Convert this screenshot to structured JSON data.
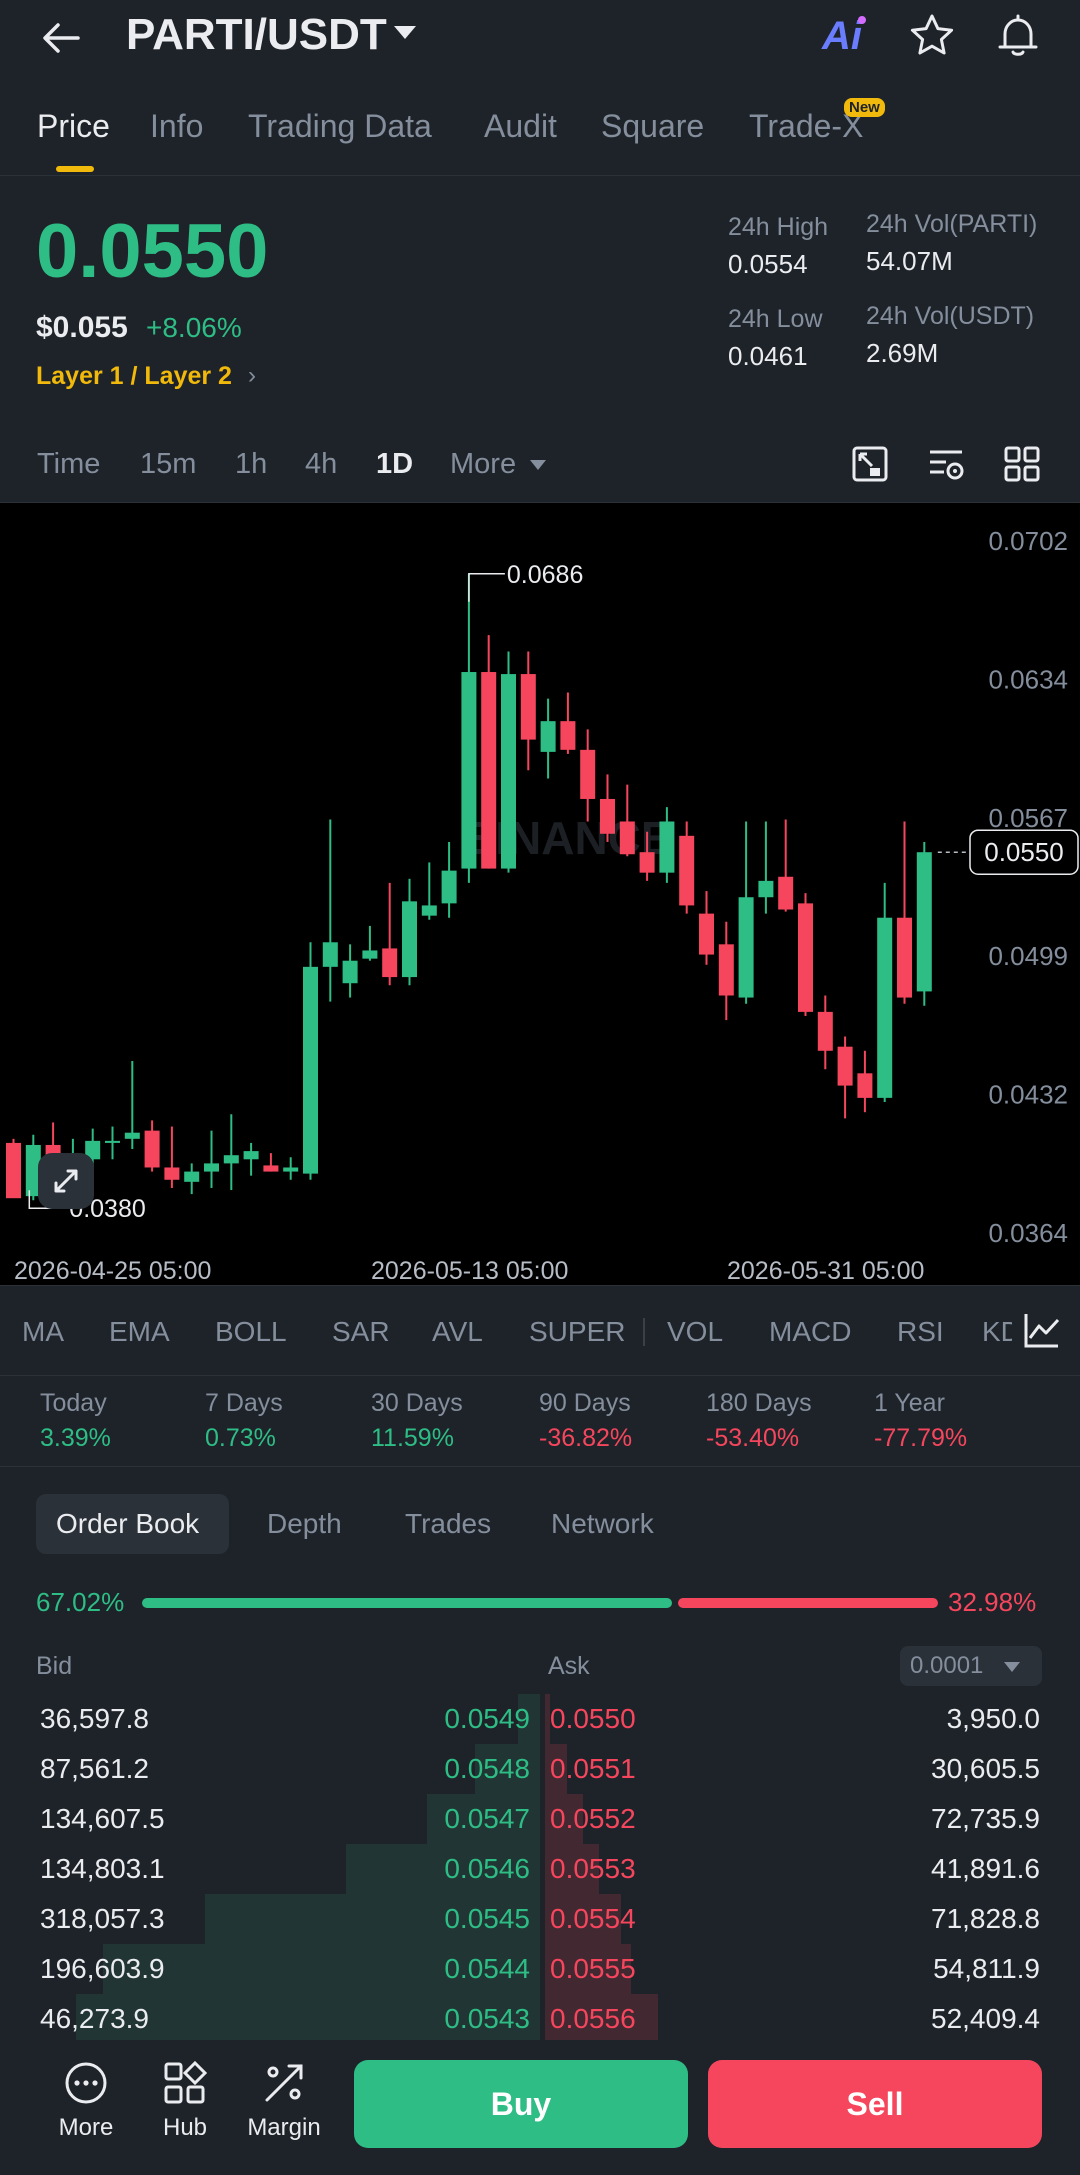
{
  "header": {
    "pair": "PARTI/USDT",
    "ai_label": "Ai"
  },
  "tabs": [
    {
      "label": "Price"
    },
    {
      "label": "Info"
    },
    {
      "label": "Trading Data"
    },
    {
      "label": "Audit"
    },
    {
      "label": "Square"
    },
    {
      "label": "Trade-X"
    }
  ],
  "new_badge": "New",
  "price": {
    "last": "0.0550",
    "usd": "$0.055",
    "change": "+8.06%",
    "sector": "Layer 1 / Layer 2"
  },
  "stats": {
    "high_label": "24h High",
    "high_value": "0.0554",
    "low_label": "24h Low",
    "low_value": "0.0461",
    "vol_base_label": "24h Vol(PARTI)",
    "vol_base_value": "54.07M",
    "vol_quote_label": "24h Vol(USDT)",
    "vol_quote_value": "2.69M"
  },
  "intervals": [
    {
      "label": "Time"
    },
    {
      "label": "15m"
    },
    {
      "label": "1h"
    },
    {
      "label": "4h"
    },
    {
      "label": "1D"
    },
    {
      "label": "More"
    }
  ],
  "chart_data": {
    "type": "candlestick",
    "watermark": "BINANCE",
    "y_ticks": [
      "0.0702",
      "0.0634",
      "0.0567",
      "0.0499",
      "0.0432",
      "0.0364"
    ],
    "ylim": [
      0.0364,
      0.0702
    ],
    "x_ticks": [
      "2026-04-25 05:00",
      "2026-05-13 05:00",
      "2026-05-31 05:00"
    ],
    "last_price": "0.0550",
    "max_label": "0.0686",
    "min_label": "0.0380",
    "up_color": "#2ebd85",
    "down_color": "#f6465d",
    "candles": [
      {
        "o": 0.0408,
        "h": 0.041,
        "l": 0.0382,
        "c": 0.0381
      },
      {
        "o": 0.0382,
        "h": 0.0412,
        "l": 0.038,
        "c": 0.0407
      },
      {
        "o": 0.0407,
        "h": 0.0418,
        "l": 0.0395,
        "c": 0.04
      },
      {
        "o": 0.04,
        "h": 0.041,
        "l": 0.039,
        "c": 0.0401
      },
      {
        "o": 0.04,
        "h": 0.0415,
        "l": 0.0392,
        "c": 0.0409
      },
      {
        "o": 0.0408,
        "h": 0.0416,
        "l": 0.04,
        "c": 0.0409
      },
      {
        "o": 0.041,
        "h": 0.0448,
        "l": 0.0405,
        "c": 0.0413
      },
      {
        "o": 0.0414,
        "h": 0.0419,
        "l": 0.0394,
        "c": 0.0396
      },
      {
        "o": 0.0396,
        "h": 0.0416,
        "l": 0.0386,
        "c": 0.039
      },
      {
        "o": 0.0389,
        "h": 0.0398,
        "l": 0.0383,
        "c": 0.0394
      },
      {
        "o": 0.0394,
        "h": 0.0414,
        "l": 0.0386,
        "c": 0.0398
      },
      {
        "o": 0.0398,
        "h": 0.0422,
        "l": 0.0385,
        "c": 0.0402
      },
      {
        "o": 0.04,
        "h": 0.0408,
        "l": 0.0392,
        "c": 0.0404
      },
      {
        "o": 0.0397,
        "h": 0.0403,
        "l": 0.0394,
        "c": 0.0394
      },
      {
        "o": 0.0394,
        "h": 0.0401,
        "l": 0.039,
        "c": 0.0396
      },
      {
        "o": 0.0393,
        "h": 0.0506,
        "l": 0.039,
        "c": 0.0494
      },
      {
        "o": 0.0494,
        "h": 0.0566,
        "l": 0.0477,
        "c": 0.0506
      },
      {
        "o": 0.0486,
        "h": 0.0505,
        "l": 0.0479,
        "c": 0.0497
      },
      {
        "o": 0.0498,
        "h": 0.0514,
        "l": 0.0497,
        "c": 0.0502
      },
      {
        "o": 0.0503,
        "h": 0.0535,
        "l": 0.0485,
        "c": 0.0489
      },
      {
        "o": 0.0489,
        "h": 0.0537,
        "l": 0.0485,
        "c": 0.0526
      },
      {
        "o": 0.0519,
        "h": 0.0545,
        "l": 0.0517,
        "c": 0.0524
      },
      {
        "o": 0.0525,
        "h": 0.0555,
        "l": 0.0518,
        "c": 0.0541
      },
      {
        "o": 0.0542,
        "h": 0.0686,
        "l": 0.0535,
        "c": 0.0638
      },
      {
        "o": 0.0638,
        "h": 0.0656,
        "l": 0.0542,
        "c": 0.0542
      },
      {
        "o": 0.0542,
        "h": 0.0648,
        "l": 0.054,
        "c": 0.0637
      },
      {
        "o": 0.0637,
        "h": 0.0648,
        "l": 0.059,
        "c": 0.0605
      },
      {
        "o": 0.0599,
        "h": 0.0625,
        "l": 0.0586,
        "c": 0.0614
      },
      {
        "o": 0.0614,
        "h": 0.0628,
        "l": 0.0598,
        "c": 0.06
      },
      {
        "o": 0.06,
        "h": 0.061,
        "l": 0.0565,
        "c": 0.0576
      },
      {
        "o": 0.0576,
        "h": 0.0588,
        "l": 0.0555,
        "c": 0.0559
      },
      {
        "o": 0.0565,
        "h": 0.0583,
        "l": 0.0548,
        "c": 0.0549
      },
      {
        "o": 0.055,
        "h": 0.056,
        "l": 0.0536,
        "c": 0.054
      },
      {
        "o": 0.054,
        "h": 0.0572,
        "l": 0.0535,
        "c": 0.0565
      },
      {
        "o": 0.0558,
        "h": 0.0565,
        "l": 0.052,
        "c": 0.0524
      },
      {
        "o": 0.052,
        "h": 0.0531,
        "l": 0.0495,
        "c": 0.05
      },
      {
        "o": 0.0505,
        "h": 0.0516,
        "l": 0.0468,
        "c": 0.048
      },
      {
        "o": 0.0479,
        "h": 0.0565,
        "l": 0.0476,
        "c": 0.0528
      },
      {
        "o": 0.0528,
        "h": 0.0565,
        "l": 0.052,
        "c": 0.0536
      },
      {
        "o": 0.0538,
        "h": 0.0566,
        "l": 0.0521,
        "c": 0.0522
      },
      {
        "o": 0.0525,
        "h": 0.053,
        "l": 0.047,
        "c": 0.0472
      },
      {
        "o": 0.0472,
        "h": 0.048,
        "l": 0.0444,
        "c": 0.0453
      },
      {
        "o": 0.0455,
        "h": 0.046,
        "l": 0.042,
        "c": 0.0436
      },
      {
        "o": 0.0442,
        "h": 0.0453,
        "l": 0.0423,
        "c": 0.043
      },
      {
        "o": 0.043,
        "h": 0.0535,
        "l": 0.0428,
        "c": 0.0518
      },
      {
        "o": 0.0518,
        "h": 0.0565,
        "l": 0.0476,
        "c": 0.0479
      },
      {
        "o": 0.0482,
        "h": 0.0555,
        "l": 0.0475,
        "c": 0.055
      }
    ]
  },
  "indicators": [
    {
      "label": "MA"
    },
    {
      "label": "EMA"
    },
    {
      "label": "BOLL"
    },
    {
      "label": "SAR"
    },
    {
      "label": "AVL"
    },
    {
      "label": "SUPER"
    },
    {
      "label": "VOL"
    },
    {
      "label": "MACD"
    },
    {
      "label": "RSI"
    },
    {
      "label": "KD"
    }
  ],
  "performance": [
    {
      "label": "Today",
      "value": "3.39%",
      "color": "#2ebd85"
    },
    {
      "label": "7 Days",
      "value": "0.73%",
      "color": "#2ebd85"
    },
    {
      "label": "30 Days",
      "value": "11.59%",
      "color": "#2ebd85"
    },
    {
      "label": "90 Days",
      "value": "-36.82%",
      "color": "#f6465d"
    },
    {
      "label": "180 Days",
      "value": "-53.40%",
      "color": "#f6465d"
    },
    {
      "label": "1 Year",
      "value": "-77.79%",
      "color": "#f6465d"
    }
  ],
  "orderbook": {
    "tabs": [
      {
        "label": "Order Book"
      },
      {
        "label": "Depth"
      },
      {
        "label": "Trades"
      },
      {
        "label": "Network"
      }
    ],
    "bid_ratio": "67.02%",
    "ask_ratio": "32.98%",
    "bid_header": "Bid",
    "ask_header": "Ask",
    "precision": "0.0001",
    "rows": [
      {
        "bid_qty": "36,597.8",
        "bid_price": "0.0549",
        "ask_price": "0.0550",
        "ask_qty": "3,950.0",
        "bid_depth": 0.04,
        "ask_depth": 0.01
      },
      {
        "bid_qty": "87,561.2",
        "bid_price": "0.0548",
        "ask_price": "0.0551",
        "ask_qty": "30,605.5",
        "bid_depth": 0.12,
        "ask_depth": 0.04
      },
      {
        "bid_qty": "134,607.5",
        "bid_price": "0.0547",
        "ask_price": "0.0552",
        "ask_qty": "72,735.9",
        "bid_depth": 0.21,
        "ask_depth": 0.07
      },
      {
        "bid_qty": "134,803.1",
        "bid_price": "0.0546",
        "ask_price": "0.0553",
        "ask_qty": "41,891.6",
        "bid_depth": 0.36,
        "ask_depth": 0.1
      },
      {
        "bid_qty": "318,057.3",
        "bid_price": "0.0545",
        "ask_price": "0.0554",
        "ask_qty": "71,828.8",
        "bid_depth": 0.62,
        "ask_depth": 0.14
      },
      {
        "bid_qty": "196,603.9",
        "bid_price": "0.0544",
        "ask_price": "0.0555",
        "ask_qty": "54,811.9",
        "bid_depth": 0.81,
        "ask_depth": 0.16
      },
      {
        "bid_qty": "46,273.9",
        "bid_price": "0.0543",
        "ask_price": "0.0556",
        "ask_qty": "52,409.4",
        "bid_depth": 0.86,
        "ask_depth": 0.21
      }
    ]
  },
  "bottom_bar": {
    "more": "More",
    "hub": "Hub",
    "margin": "Margin",
    "buy": "Buy",
    "sell": "Sell"
  }
}
